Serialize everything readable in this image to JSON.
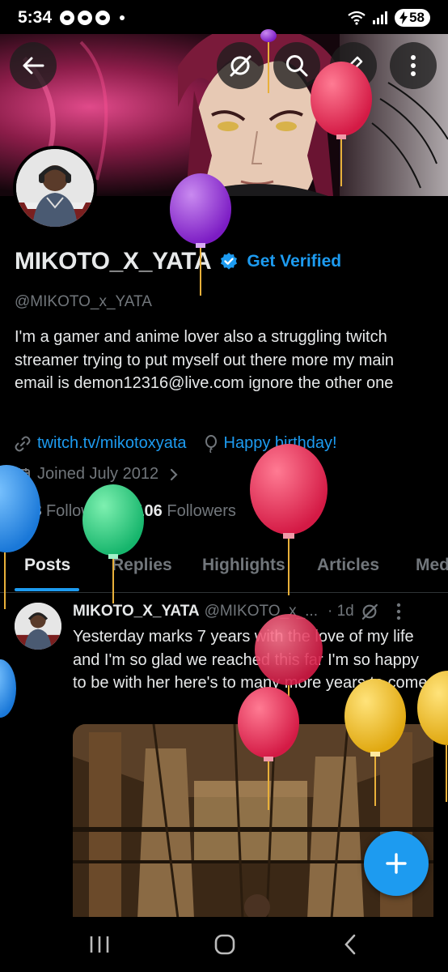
{
  "status_bar": {
    "time": "5:34",
    "battery": "58"
  },
  "profile": {
    "display_name": "MIKOTO_X_YATA",
    "get_verified": "Get Verified",
    "handle": "@MIKOTO_x_YATA",
    "bio": "I'm a gamer and anime lover also a struggling twitch streamer trying to put myself out there more my main email is demon12316@live.com ignore the other one",
    "website": "twitch.tv/mikotoxyata",
    "birthday": "Happy birthday!",
    "joined": "Joined July 2012",
    "following_count": "268",
    "following_label": "Following",
    "followers_count": "106",
    "followers_label": "Followers"
  },
  "tabs": [
    {
      "label": "Posts",
      "active": true
    },
    {
      "label": "Replies",
      "active": false
    },
    {
      "label": "Highlights",
      "active": false
    },
    {
      "label": "Articles",
      "active": false
    },
    {
      "label": "Med",
      "active": false
    }
  ],
  "post": {
    "author_name": "MIKOTO_X_YATA",
    "author_handle": "@MIKOTO_x_...",
    "time": "· 1d",
    "text": "Yesterday marks 7 years with the love of my life and I'm so glad we reached this far I'm so happy to be with her here's to many more years to come"
  },
  "colors": {
    "accent": "#1d9bf0",
    "background": "#000000",
    "text_primary": "#e7e9ea",
    "text_secondary": "#71767b"
  },
  "icons": {
    "back": "arrow-left-icon",
    "translate": "grok-slash-icon",
    "search": "search-icon",
    "edit": "pencil-icon",
    "more": "more-vertical-icon",
    "verified": "verified-badge-icon",
    "link": "link-icon",
    "birthday": "balloon-icon",
    "calendar": "calendar-icon",
    "compose": "plus-icon"
  }
}
